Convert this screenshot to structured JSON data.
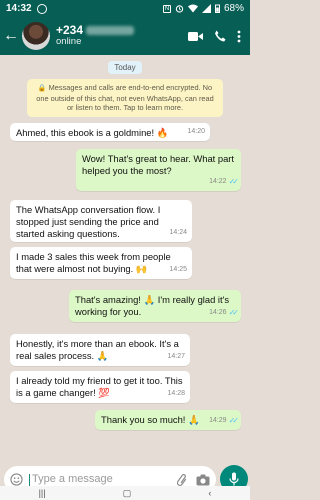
{
  "status_bar": {
    "time": "14:32",
    "battery": "68%"
  },
  "header": {
    "name": "+234",
    "status": "online"
  },
  "chat": {
    "day_label": "Today",
    "encryption_notice": "Messages and calls are end-to-end encrypted. No one outside of this chat, not even WhatsApp, can read or listen to them. Tap to learn more.",
    "messages": [
      {
        "dir": "in",
        "text": "Ahmed, this ebook is a goldmine! 🔥",
        "time": "14:20"
      },
      {
        "dir": "out",
        "text": "Wow! That's great to hear. What part helped you the most?",
        "time": "14:22"
      },
      {
        "dir": "in",
        "text": "The WhatsApp conversation flow. I stopped just sending the price and started asking questions.",
        "time": "14:24"
      },
      {
        "dir": "in",
        "text": "I made 3 sales this week from people that were almost not buying. 🙌",
        "time": "14:25"
      },
      {
        "dir": "out",
        "text": "That's amazing! 🙏 I'm really glad it's working for you.",
        "time": "14:26"
      },
      {
        "dir": "in",
        "text": "Honestly, it's more than an ebook. It's a real sales process. 🙏",
        "time": "14:27"
      },
      {
        "dir": "in",
        "text": "I already told my friend to get it too. This is a game changer! 💯",
        "time": "14:28"
      },
      {
        "dir": "out",
        "text": "Thank you so much! 🙏",
        "time": "14:29"
      }
    ]
  },
  "composer": {
    "placeholder": "Type a message"
  },
  "colors": {
    "header": "#075e54",
    "outgoing": "#dcf8c6",
    "incoming": "#ffffff",
    "read_tick": "#4fc3f7",
    "mic": "#00897b"
  }
}
